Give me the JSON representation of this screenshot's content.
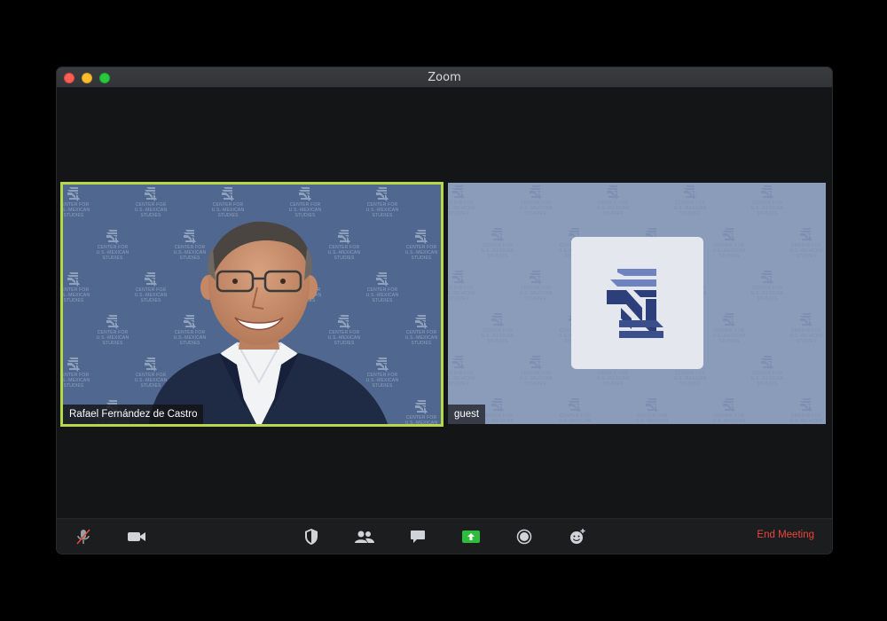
{
  "window": {
    "title": "Zoom"
  },
  "participants": [
    {
      "name": "Rafael Fernández de Castro",
      "active_speaker": true
    },
    {
      "name": "guest",
      "active_speaker": false
    }
  ],
  "backdrop": {
    "line1": "CENTER FOR",
    "line2": "U.S.-MEXICAN",
    "line3": "STUDIES"
  },
  "toolbar": {
    "buttons": [
      "mute-microphone",
      "stop-video",
      "security",
      "participants",
      "chat",
      "share-screen",
      "record",
      "reactions"
    ],
    "end_label": "End Meeting"
  },
  "colors": {
    "active_border": "#b7d84a",
    "end_meeting": "#e8473c",
    "share": "#2dbc3c"
  }
}
